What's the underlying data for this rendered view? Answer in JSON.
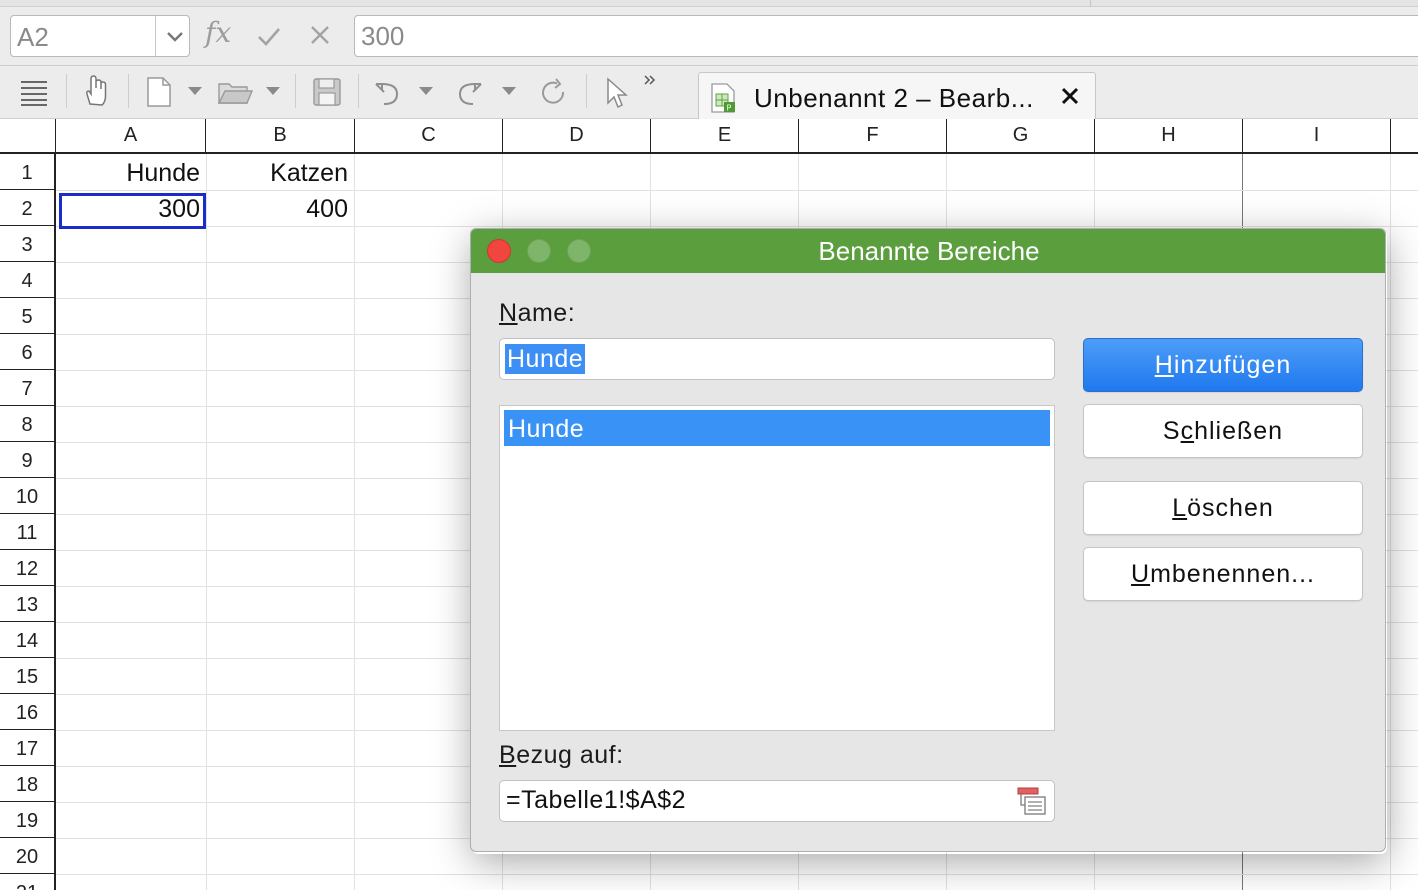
{
  "formula_bar": {
    "name_box_value": "A2",
    "function_wizard_label": "fx",
    "formula_value": "300"
  },
  "toolbar": {
    "document_tab": {
      "title": "Unbenannt 2 – Bearb..."
    }
  },
  "sheet": {
    "columns": [
      "A",
      "B",
      "C",
      "D",
      "E",
      "F",
      "G",
      "H",
      "I"
    ],
    "rows": [
      "1",
      "2",
      "3",
      "4",
      "5",
      "6",
      "7",
      "8",
      "9",
      "10",
      "11",
      "12",
      "13",
      "14",
      "15",
      "16",
      "17",
      "18",
      "19",
      "20",
      "21"
    ],
    "cells": {
      "A1": "Hunde",
      "B1": "Katzen",
      "A2": "300",
      "B2": "400"
    },
    "active_cell": "A2"
  },
  "dialog": {
    "title": "Benannte Bereiche",
    "name_label_mnemonic": "N",
    "name_label_rest": "ame:",
    "name_value": "Hunde",
    "list_items": [
      "Hunde"
    ],
    "ref_label_mnemonic": "B",
    "ref_label_rest": "ezug auf:",
    "ref_value": "=Tabelle1!$A$2",
    "buttons": {
      "add": {
        "mnemonic": "H",
        "rest": "inzufügen"
      },
      "close": {
        "pre": "S",
        "mnemonic": "c",
        "rest": "hließen"
      },
      "delete": {
        "mnemonic": "L",
        "rest": "öschen"
      },
      "rename": {
        "mnemonic": "U",
        "rest": "mbenennen..."
      }
    }
  },
  "colors": {
    "dialog_titlebar": "#5a9e3e",
    "selection_blue": "#3993f6",
    "cell_cursor": "#1a2dc9",
    "traffic_close": "#f0463f",
    "traffic_inactive": "#7fb56a"
  }
}
